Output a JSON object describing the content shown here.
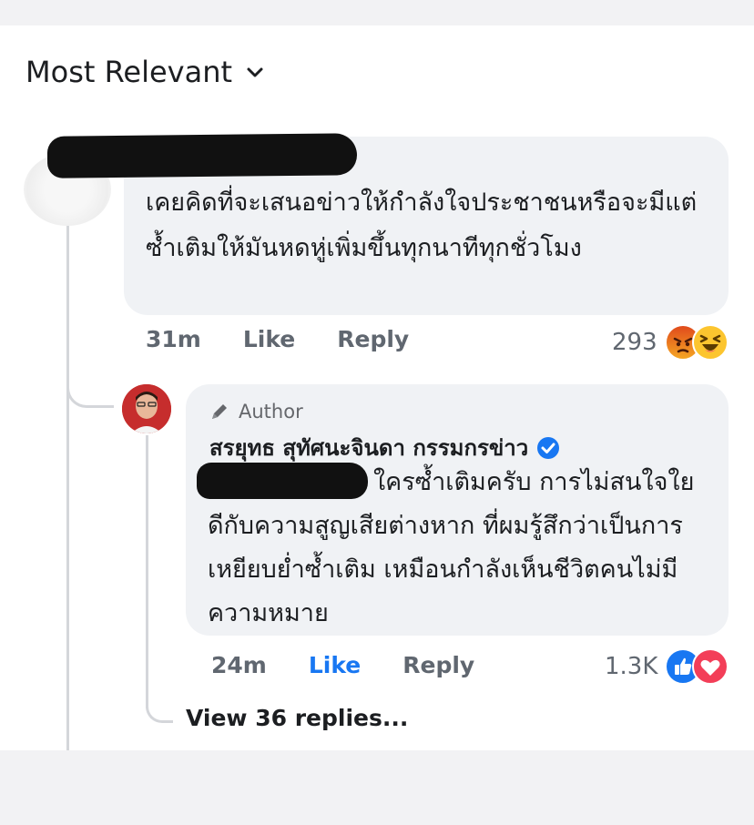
{
  "sort": {
    "label": "Most Relevant"
  },
  "comment1": {
    "text": "เคยคิดที่จะเสนอข่าวให้กำลังใจประชาชนหรือจะมีแต่ซ้ำเติมให้มันหดหู่เพิ่มขึ้นทุกนาทีทุกชั่วโมง",
    "time": "31m",
    "like_label": "Like",
    "reply_label": "Reply",
    "reaction_count": "293",
    "reactions": [
      "angry-icon",
      "haha-icon"
    ]
  },
  "reply1": {
    "badge": "Author",
    "author": "สรยุทธ สุทัศนะจินดา กรรมกรข่าว",
    "text": "ใครซ้ำเติมครับ การไม่สนใจใยดีกับความสูญเสียต่างหาก ที่ผมรู้สึกว่าเป็นการเหยียบย่ำซ้ำเติม เหมือนกำลังเห็นชีวิตคนไม่มีความหมาย",
    "time": "24m",
    "like_label": "Like",
    "reply_label": "Reply",
    "reaction_count": "1.3K",
    "reactions": [
      "like-icon",
      "love-icon"
    ]
  },
  "view_replies": {
    "label": "View 36 replies..."
  },
  "colors": {
    "link_blue": "#1877f2",
    "bubble": "#f0f2f5",
    "meta": "#606770"
  }
}
